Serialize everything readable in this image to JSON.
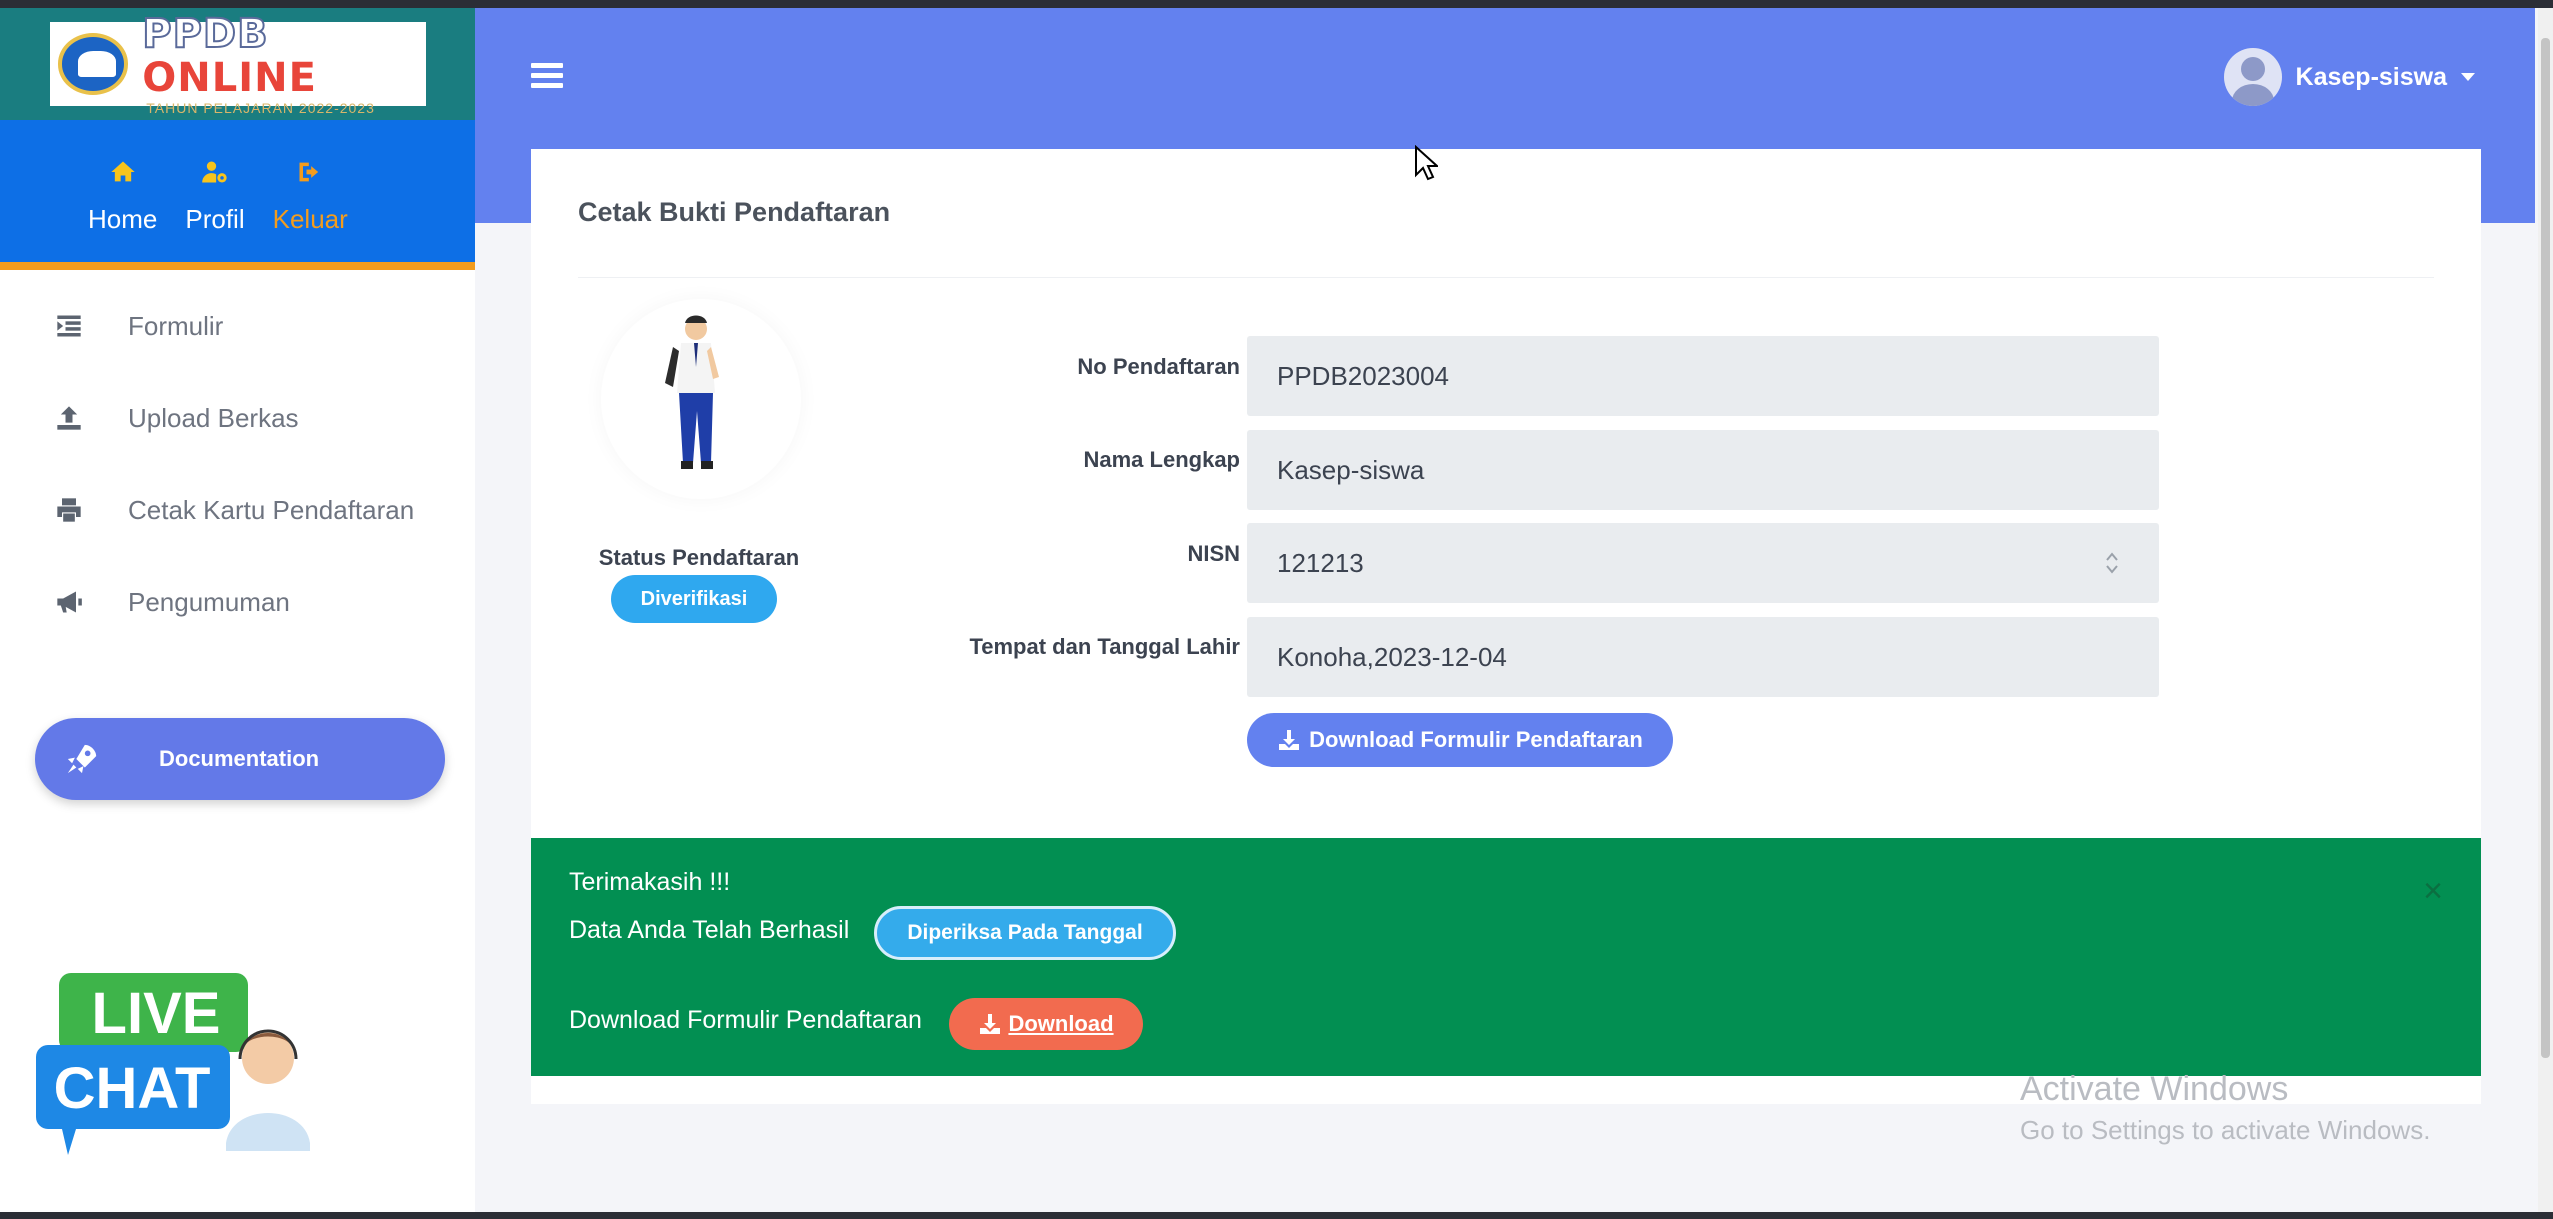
{
  "brand": {
    "title_part1": "PPDB",
    "title_part2": "ONLINE",
    "subtitle": "TAHUN PELAJARAN 2022-2023"
  },
  "quick_nav": [
    {
      "label": "Home",
      "icon": "home-icon"
    },
    {
      "label": "Profil",
      "icon": "user-gear-icon"
    },
    {
      "label": "Keluar",
      "icon": "sign-out-icon"
    }
  ],
  "sidebar": {
    "items": [
      {
        "label": "Formulir",
        "icon": "form-list-icon"
      },
      {
        "label": "Upload Berkas",
        "icon": "upload-icon"
      },
      {
        "label": "Cetak Kartu Pendaftaran",
        "icon": "printer-icon"
      },
      {
        "label": "Pengumuman",
        "icon": "megaphone-icon"
      }
    ],
    "documentation_label": "Documentation",
    "live_chat_line1": "LIVE",
    "live_chat_line2": "CHAT"
  },
  "header": {
    "user_name": "Kasep-siswa"
  },
  "card": {
    "title": "Cetak Bukti Pendaftaran",
    "status_label": "Status Pendaftaran",
    "status_badge": "Diverifikasi",
    "fields": [
      {
        "label": "No Pendaftaran",
        "value": "PPDB2023004"
      },
      {
        "label": "Nama Lengkap",
        "value": "Kasep-siswa"
      },
      {
        "label": "NISN",
        "value": "121213"
      },
      {
        "label": "Tempat dan Tanggal Lahir",
        "value": "Konoha,2023-12-04"
      }
    ],
    "download_button": "Download Formulir Pendaftaran"
  },
  "alert": {
    "line1": "Terimakasih !!!",
    "line2": "Data Anda Telah Berhasil",
    "checked_badge": "Diperiksa Pada Tanggal",
    "line3": "Download Formulir Pendaftaran",
    "download_button": "Download",
    "close": "×"
  },
  "watermark": {
    "title": "Activate Windows",
    "subtitle": "Go to Settings to activate Windows."
  },
  "colors": {
    "header": "#6381ef",
    "quick_nav_bg": "#0d6fe6",
    "accent_orange": "#f39c1d",
    "alert_green": "#028f52",
    "badge_blue": "#2fa8ef",
    "download_red": "#f26b4f"
  }
}
